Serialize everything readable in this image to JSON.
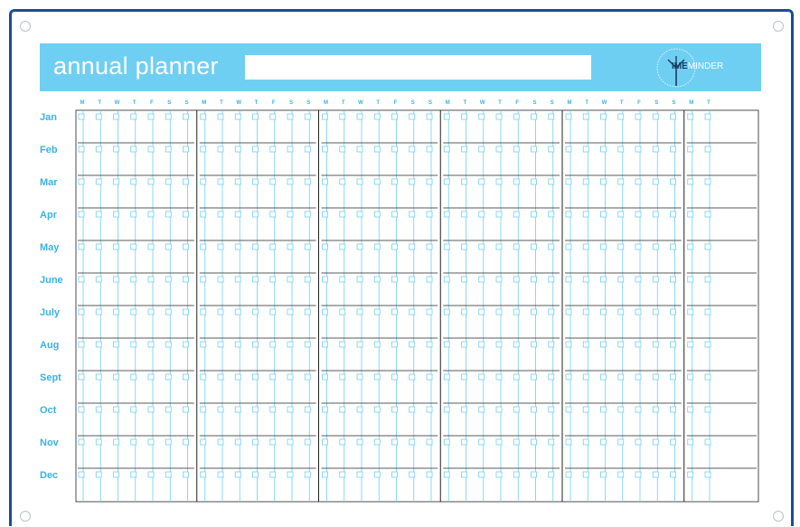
{
  "header": {
    "title": "annual planner",
    "logo_text_bold": "IME",
    "logo_text_light": "MINDER",
    "logo_icon": "windmill-icon"
  },
  "days": [
    "M",
    "T",
    "W",
    "T",
    "F",
    "S",
    "S",
    "M",
    "T",
    "W",
    "T",
    "F",
    "S",
    "S",
    "M",
    "T",
    "W",
    "T",
    "F",
    "S",
    "S",
    "M",
    "T",
    "W",
    "T",
    "F",
    "S",
    "S",
    "M",
    "T",
    "W",
    "T",
    "F",
    "S",
    "S",
    "M",
    "T"
  ],
  "months": [
    "Jan",
    "Feb",
    "Mar",
    "Apr",
    "May",
    "June",
    "July",
    "Aug",
    "Sept",
    "Oct",
    "Nov",
    "Dec"
  ],
  "colors": {
    "accent": "#6fcff3",
    "label": "#3ab2e2",
    "frame": "#1a4e91",
    "grid_line": "#6fcff3",
    "rule": "#222222"
  }
}
